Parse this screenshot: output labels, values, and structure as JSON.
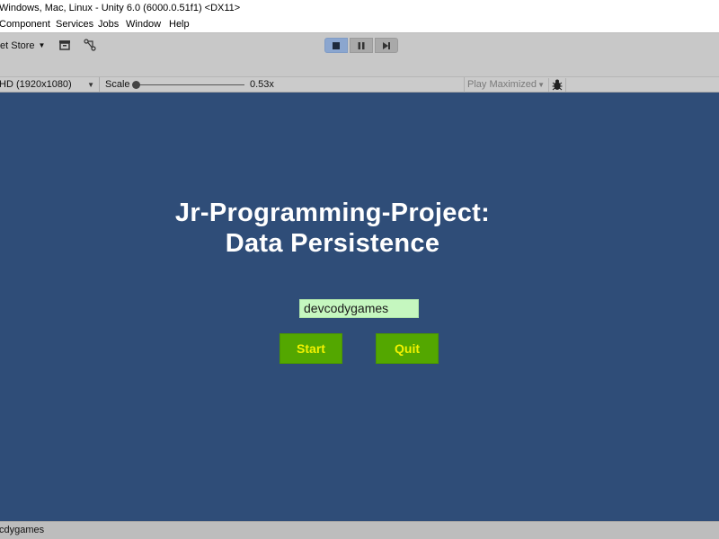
{
  "window": {
    "title": "Windows, Mac, Linux - Unity 6.0 (6000.0.51f1) <DX11>"
  },
  "menu": {
    "items": [
      "Component",
      "Services",
      "Jobs",
      "Window",
      "Help"
    ]
  },
  "toolbar": {
    "asset_store_label": "et Store",
    "play_controls": {
      "play_active": true,
      "icons": [
        "stop-icon",
        "pause-icon",
        "step-icon"
      ]
    }
  },
  "game_bar": {
    "resolution": "HD (1920x1080)",
    "scale_label": "Scale",
    "scale_value": "0.53x",
    "scale_fraction": 0.0,
    "play_mode": "Play Maximized"
  },
  "game": {
    "title_line1": "Jr-Programming-Project:",
    "title_line2": "Data Persistence",
    "name_input_value": "devcodygames",
    "start_label": "Start",
    "quit_label": "Quit",
    "colors": {
      "background": "#2f4d78",
      "button": "#53a700",
      "button_text": "#f2f200",
      "input": "#c5f7bf"
    }
  },
  "status_bar": {
    "text": "cdygames"
  }
}
